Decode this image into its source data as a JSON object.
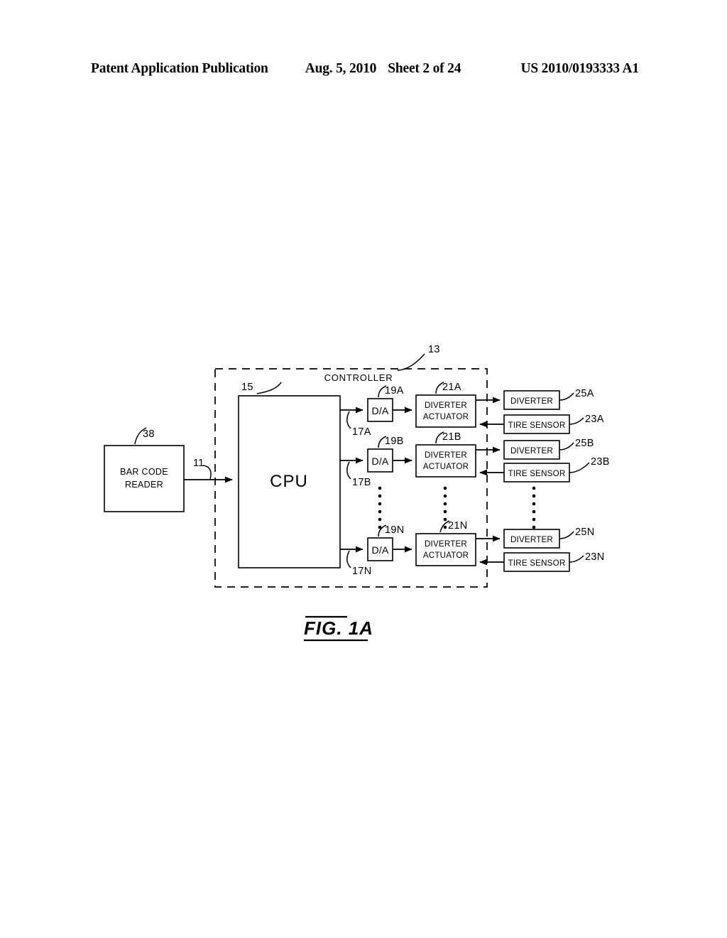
{
  "page": {
    "header": {
      "publication": "Patent Application Publication",
      "date": "Aug. 5, 2010",
      "sheet": "Sheet 2 of 24",
      "patent_number": "US 2010/0193333 A1"
    },
    "figure_caption": "FIG. 1A"
  },
  "diagram": {
    "type": "block-diagram",
    "controller": {
      "label": "CONTROLLER",
      "ref": "13"
    },
    "bar_code_reader": {
      "label_line1": "BAR CODE",
      "label_line2": "READER",
      "ref": "38"
    },
    "cpu": {
      "label": "CPU",
      "ref": "15"
    },
    "input_signal_ref": "11",
    "channels": [
      {
        "suffix": "A",
        "line_ref": "17A",
        "da": {
          "label": "D/A",
          "ref": "19A"
        },
        "actuator": {
          "label_line1": "DIVERTER",
          "label_line2": "ACTUATOR",
          "ref": "21A"
        },
        "diverter": {
          "label": "DIVERTER",
          "ref": "25A"
        },
        "tire_sensor": {
          "label": "TIRE SENSOR",
          "ref": "23A"
        }
      },
      {
        "suffix": "B",
        "line_ref": "17B",
        "da": {
          "label": "D/A",
          "ref": "19B"
        },
        "actuator": {
          "label_line1": "DIVERTER",
          "label_line2": "ACTUATOR",
          "ref": "21B"
        },
        "diverter": {
          "label": "DIVERTER",
          "ref": "25B"
        },
        "tire_sensor": {
          "label": "TIRE SENSOR",
          "ref": "23B"
        }
      },
      {
        "suffix": "N",
        "line_ref": "17N",
        "da": {
          "label": "D/A",
          "ref": "19N"
        },
        "actuator": {
          "label_line1": "DIVERTER",
          "label_line2": "ACTUATOR",
          "ref": "21N"
        },
        "diverter": {
          "label": "DIVERTER",
          "ref": "25N"
        },
        "tire_sensor": {
          "label": "TIRE SENSOR",
          "ref": "23N"
        }
      }
    ],
    "continuation_marker": "vertical-ellipsis"
  },
  "colors": {
    "ink": "#000000",
    "paper": "#ffffff"
  }
}
